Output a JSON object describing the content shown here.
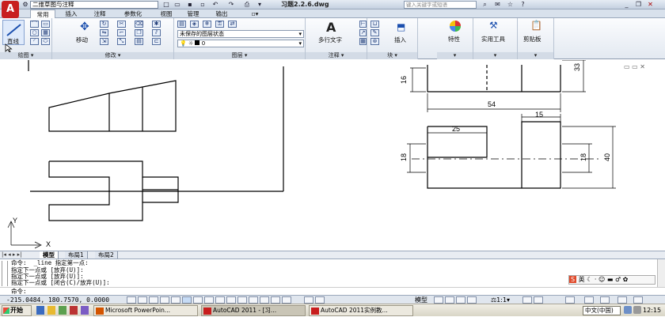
{
  "titlebar": {
    "app_logo": "A",
    "workspace": "二维草图与注释",
    "document_title": "习题2.2.6.dwg",
    "search_placeholder": "键入关键字或短语"
  },
  "tabs": [
    {
      "label": "常用",
      "active": true
    },
    {
      "label": "插入",
      "active": false
    },
    {
      "label": "注释",
      "active": false
    },
    {
      "label": "参数化",
      "active": false
    },
    {
      "label": "视图",
      "active": false
    },
    {
      "label": "管理",
      "active": false
    },
    {
      "label": "输出",
      "active": false
    }
  ],
  "ribbon": {
    "line_label": "直线",
    "move_label": "移动",
    "layer_state": "未保存的图层状态",
    "layer_current": "0",
    "mtext_label": "多行文字",
    "insert_label": "插入",
    "properties_label": "特性",
    "utilities_label": "实用工具",
    "clipboard_label": "剪贴板",
    "panels": {
      "draw": "绘图",
      "modify": "修改",
      "layers": "图层",
      "annotation": "注释",
      "block": "块"
    }
  },
  "drawing": {
    "dimensions": [
      "16",
      "33",
      "54",
      "15",
      "25",
      "18",
      "18",
      "40"
    ],
    "ucs_x": "X",
    "ucs_y": "Y"
  },
  "layout_tabs": [
    "模型",
    "布局1",
    "布局2"
  ],
  "command": {
    "history": [
      "命令:  _line 指定第一点:",
      "指定下一点或 [放弃(U)]:",
      "指定下一点或 [放弃(U)]:",
      "指定下一点或 [闭合(C)/放弃(U)]:"
    ],
    "prompt": "命令:"
  },
  "status": {
    "coordinates": "-215.0484, 180.7570, 0.0000",
    "model": "模型",
    "annotation_scale": "1:1"
  },
  "ime": {
    "label": "英"
  },
  "taskbar": {
    "start": "开始",
    "items": [
      "Microsoft PowerPoin...",
      "AutoCAD 2011 - [习...",
      "AutoCAD 2011实例教..."
    ],
    "input_lang": "中文(中国)",
    "time": "12:15"
  },
  "colors": {
    "logo": "#c81e1e",
    "ribbon_bg": "#e3e9f1",
    "taskbar_bg": "#d9d5c6"
  }
}
